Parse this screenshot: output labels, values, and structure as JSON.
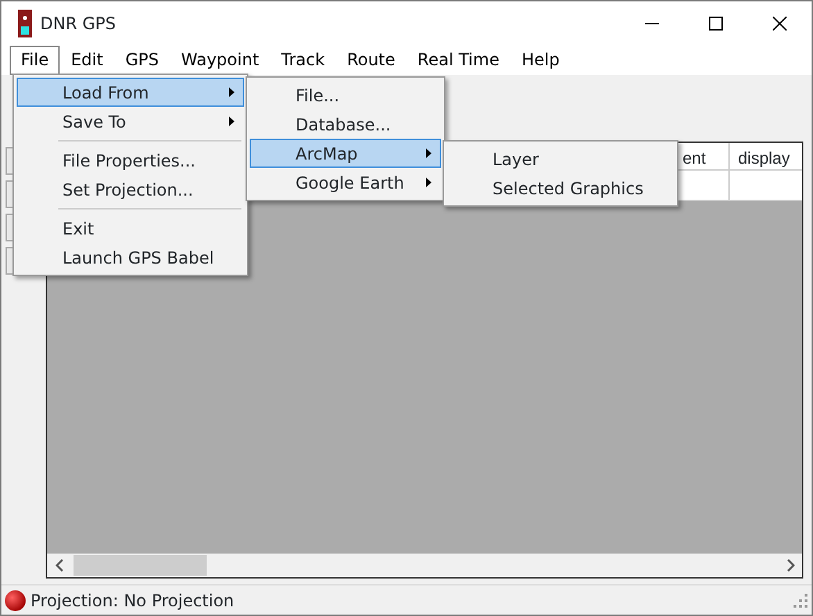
{
  "window": {
    "title": "DNR GPS"
  },
  "menu_bar": [
    {
      "label": "File",
      "selected": true
    },
    {
      "label": "Edit",
      "selected": false
    },
    {
      "label": "GPS",
      "selected": false
    },
    {
      "label": "Waypoint",
      "selected": false
    },
    {
      "label": "Track",
      "selected": false
    },
    {
      "label": "Route",
      "selected": false
    },
    {
      "label": "Real Time",
      "selected": false
    },
    {
      "label": "Help",
      "selected": false
    }
  ],
  "menus": [
    {
      "items": [
        {
          "kind": "item",
          "label": "Load From",
          "submenu": true,
          "selected": true
        },
        {
          "kind": "item",
          "label": "Save To",
          "submenu": true,
          "selected": false
        },
        {
          "kind": "separator"
        },
        {
          "kind": "item",
          "label": "File Properties...",
          "submenu": false,
          "selected": false
        },
        {
          "kind": "item",
          "label": "Set Projection...",
          "submenu": false,
          "selected": false
        },
        {
          "kind": "separator"
        },
        {
          "kind": "item",
          "label": "Exit",
          "submenu": false,
          "selected": false
        },
        {
          "kind": "item",
          "label": "Launch GPS Babel",
          "submenu": false,
          "selected": false
        }
      ]
    },
    {
      "items": [
        {
          "kind": "item",
          "label": "File...",
          "submenu": false,
          "selected": false
        },
        {
          "kind": "item",
          "label": "Database...",
          "submenu": false,
          "selected": false
        },
        {
          "kind": "item",
          "label": "ArcMap",
          "submenu": true,
          "selected": true
        },
        {
          "kind": "item",
          "label": "Google Earth",
          "submenu": true,
          "selected": false
        }
      ]
    },
    {
      "items": [
        {
          "kind": "item",
          "label": "Layer",
          "submenu": false,
          "selected": false
        },
        {
          "kind": "item",
          "label": "Selected Graphics",
          "submenu": false,
          "selected": false
        }
      ]
    }
  ],
  "table": {
    "columns": [
      {
        "label": "ent"
      },
      {
        "label": "display"
      }
    ]
  },
  "status_bar": {
    "text": "Projection: No Projection"
  }
}
